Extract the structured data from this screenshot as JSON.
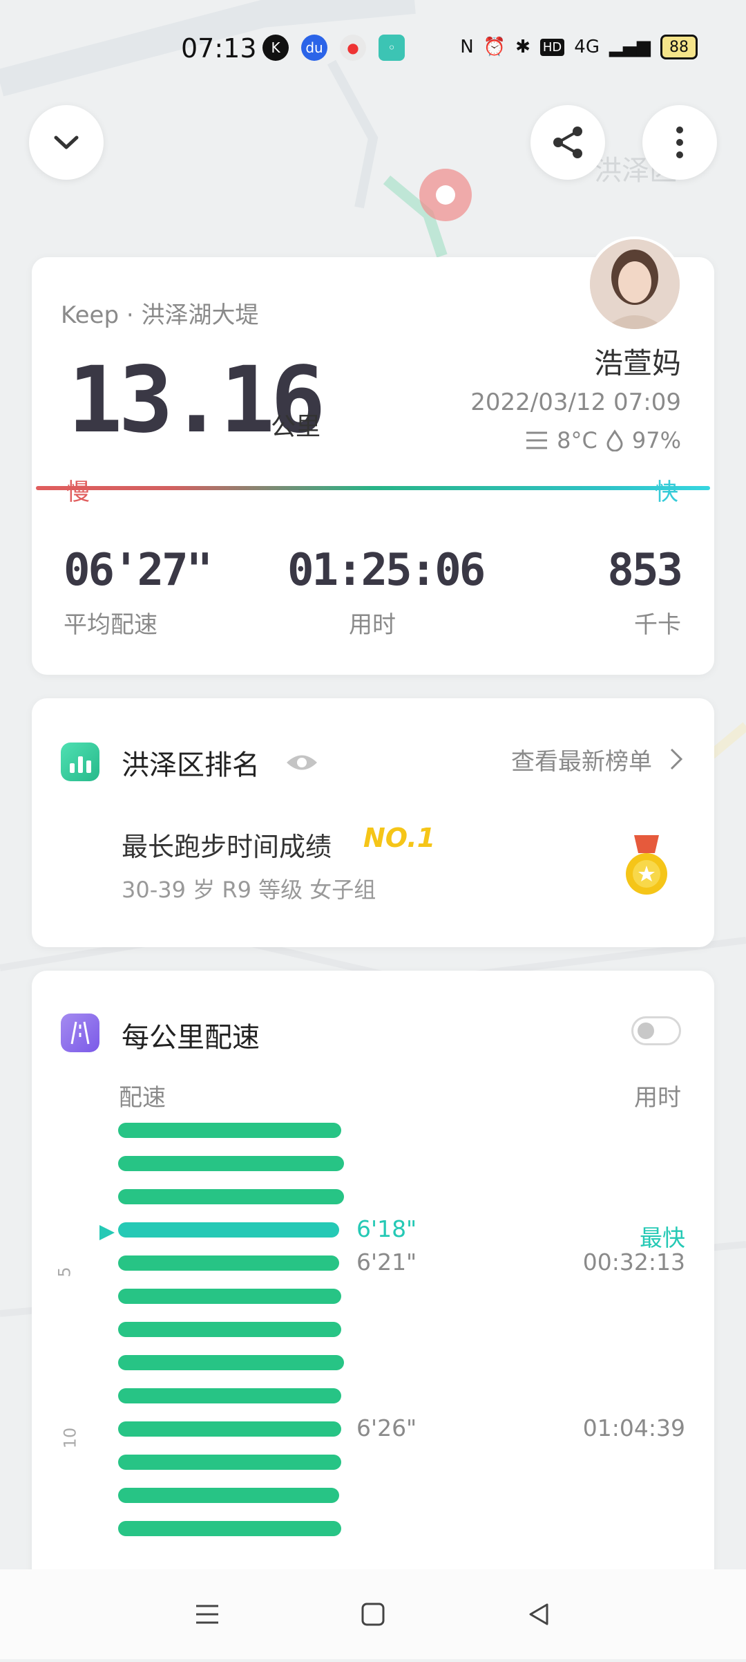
{
  "status_bar": {
    "time": "07:13",
    "battery": "88",
    "network": "4G"
  },
  "map": {
    "district_label": "洪泽区"
  },
  "summary": {
    "source": "Keep · 洪泽湖大堤",
    "distance": "13.16",
    "distance_unit": "公里",
    "user_name": "浩萱妈",
    "datetime": "2022/03/12 07:09",
    "temperature": "8°C",
    "humidity": "97%",
    "slow_label": "慢",
    "fast_label": "快",
    "stats": [
      {
        "value": "06'27\"",
        "label": "平均配速"
      },
      {
        "value": "01:25:06",
        "label": "用时"
      },
      {
        "value": "853",
        "label": "千卡"
      }
    ]
  },
  "ranking": {
    "title": "洪泽区排名",
    "link": "查看最新榜单",
    "achievement": "最长跑步时间成绩",
    "rank": "NO.1",
    "group": "30-39 岁 R9 等级 女子组"
  },
  "pace": {
    "title": "每公里配速",
    "col_pace": "配速",
    "col_time": "用时",
    "fastest_label": "最快",
    "km_marks": [
      "5",
      "10"
    ],
    "bars": [
      {
        "pace": "",
        "time": "",
        "fraction": 0.98
      },
      {
        "pace": "",
        "time": "",
        "fraction": 0.99
      },
      {
        "pace": "",
        "time": "",
        "fraction": 0.99
      },
      {
        "pace": "6'18\"",
        "time": "",
        "fraction": 0.97,
        "fastest": true
      },
      {
        "pace": "6'21\"",
        "time": "00:32:13",
        "fraction": 0.97
      },
      {
        "pace": "",
        "time": "",
        "fraction": 0.98
      },
      {
        "pace": "",
        "time": "",
        "fraction": 0.98
      },
      {
        "pace": "",
        "time": "",
        "fraction": 0.99
      },
      {
        "pace": "",
        "time": "",
        "fraction": 0.98
      },
      {
        "pace": "6'26\"",
        "time": "01:04:39",
        "fraction": 0.98
      },
      {
        "pace": "",
        "time": "",
        "fraction": 0.98
      },
      {
        "pace": "",
        "time": "",
        "fraction": 0.97
      },
      {
        "pace": "",
        "time": "",
        "fraction": 0.98
      }
    ]
  },
  "colors": {
    "pace_bar": "#27c485",
    "fastest_bar": "#25c9b5",
    "rank_gold": "#f5c518",
    "slow": "#e05d5d",
    "fast": "#36cbd8"
  }
}
